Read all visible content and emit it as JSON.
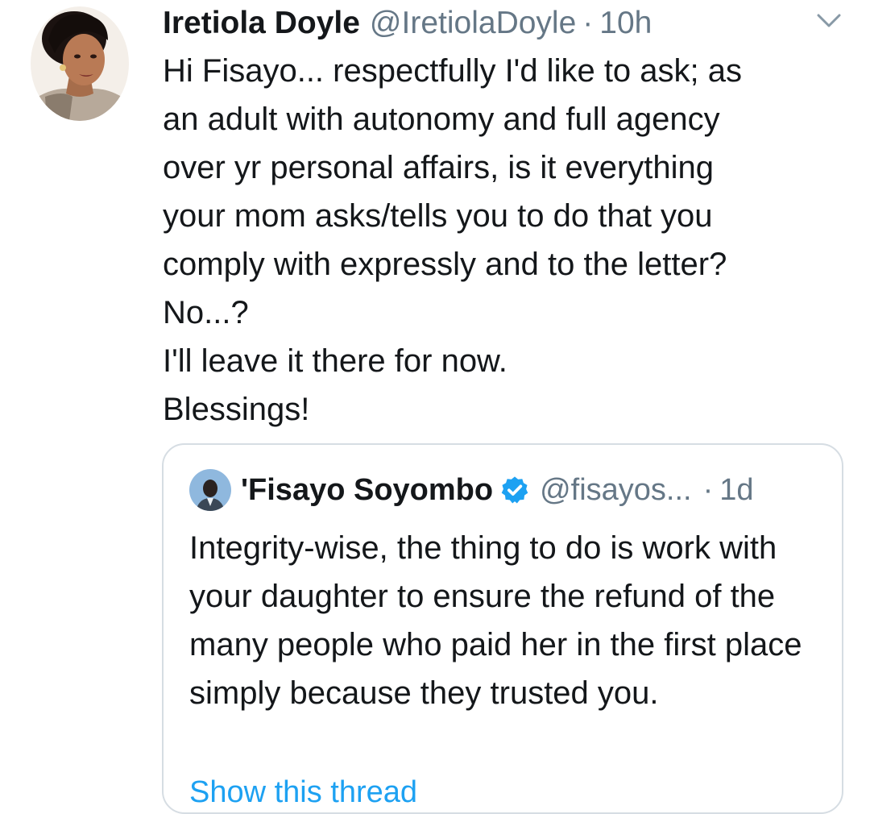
{
  "tweet": {
    "author_name": "Iretiola Doyle",
    "author_handle": "@IretiolaDoyle",
    "separator": "·",
    "time": "10h",
    "text": "Hi Fisayo... respectfully I'd like to ask; as\nan adult with autonomy and full agency\nover yr personal affairs, is it everything\nyour mom asks/tells you to do that you\ncomply with expressly and to the letter?\nNo...?\nI'll leave it there for now.\nBlessings!",
    "menu_icon": "chevron-down-icon"
  },
  "quoted_tweet": {
    "author_name": "'Fisayo Soyombo",
    "author_handle": "@fisayos...",
    "separator": "·",
    "time": "1d",
    "verified_icon": "verified-badge-icon",
    "text": "Integrity-wise, the thing to do is work with your daughter to ensure the refund of the many people who paid her in the first place simply because they trusted you.",
    "show_thread_label": "Show this thread"
  },
  "colors": {
    "text_primary": "#14171a",
    "text_secondary": "#657786",
    "link": "#1da1f2",
    "border": "#d6dde3",
    "verified": "#1da1f2"
  }
}
